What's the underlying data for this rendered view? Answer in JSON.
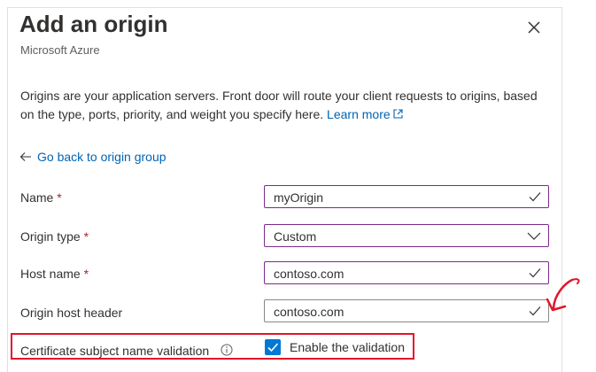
{
  "header": {
    "title": "Add an origin",
    "subtitle": "Microsoft Azure"
  },
  "description": {
    "text": "Origins are your application servers. Front door will route your client requests to origins, based on the type, ports, priority, and weight you specify here.",
    "link_label": "Learn more"
  },
  "back_link": "Go back to origin group",
  "form": {
    "name": {
      "label": "Name",
      "required_mark": "*",
      "value": "myOrigin"
    },
    "origin_type": {
      "label": "Origin type",
      "required_mark": "*",
      "value": "Custom"
    },
    "host_name": {
      "label": "Host name",
      "required_mark": "*",
      "value": "contoso.com"
    },
    "origin_host_header": {
      "label": "Origin host header",
      "value": "contoso.com"
    },
    "cert_validation": {
      "label": "Certificate subject name validation",
      "checkbox_label": "Enable the validation",
      "checked": true
    }
  },
  "colors": {
    "accent": "#0078d4",
    "link": "#0064b4",
    "focus_border": "#7b2b8c",
    "highlight": "#e3142a"
  },
  "icons": [
    "close-icon",
    "external-link-icon",
    "arrow-left-icon",
    "checkmark-icon",
    "chevron-down-icon",
    "info-icon",
    "checkbox-check-icon"
  ]
}
